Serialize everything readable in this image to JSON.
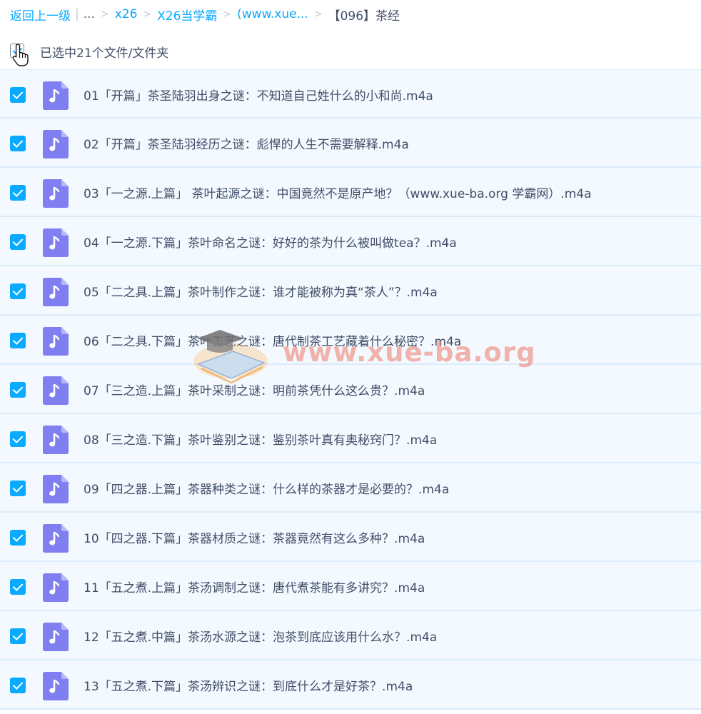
{
  "breadcrumb": {
    "back": "返回上一级",
    "pipe": "|",
    "ellipsis": "...",
    "separator": ">",
    "items": [
      "x26",
      "X26当学霸",
      "(www.xue..."
    ],
    "current": "【096】茶经"
  },
  "selection": {
    "label": "已选中21个文件/文件夹",
    "checked": true
  },
  "watermark": {
    "text": "www.xue-ba.org"
  },
  "colors": {
    "accent": "#09aaff",
    "row_background": "#f3f9ff",
    "file_icon": "#7f7ff1",
    "text": "#424e67"
  },
  "files": [
    {
      "name": "01「开篇」茶圣陆羽出身之谜：不知道自己姓什么的小和尚.m4a",
      "checked": true,
      "icon": "audio-file-icon"
    },
    {
      "name": "02「开篇」茶圣陆羽经历之谜：彪悍的人生不需要解释.m4a",
      "checked": true,
      "icon": "audio-file-icon"
    },
    {
      "name": "03「一之源.上篇」 茶叶起源之谜：中国竟然不是原产地？（www.xue-ba.org 学霸网）.m4a",
      "checked": true,
      "icon": "audio-file-icon"
    },
    {
      "name": "04「一之源.下篇」茶叶命名之谜：好好的茶为什么被叫做tea？.m4a",
      "checked": true,
      "icon": "audio-file-icon"
    },
    {
      "name": "05「二之具.上篇」茶叶制作之谜：谁才能被称为真“茶人”？.m4a",
      "checked": true,
      "icon": "audio-file-icon"
    },
    {
      "name": "06「二之具.下篇」茶叶工艺之谜：唐代制茶工艺藏着什么秘密？.m4a",
      "checked": true,
      "icon": "audio-file-icon"
    },
    {
      "name": "07「三之造.上篇」茶叶采制之谜：明前茶凭什么这么贵？.m4a",
      "checked": true,
      "icon": "audio-file-icon"
    },
    {
      "name": "08「三之造.下篇」茶叶鉴别之谜：鉴别茶叶真有奥秘窍门？.m4a",
      "checked": true,
      "icon": "audio-file-icon"
    },
    {
      "name": "09「四之器.上篇」茶器种类之谜：什么样的茶器才是必要的？.m4a",
      "checked": true,
      "icon": "audio-file-icon"
    },
    {
      "name": "10「四之器.下篇」茶器材质之谜：茶器竟然有这么多种？.m4a",
      "checked": true,
      "icon": "audio-file-icon"
    },
    {
      "name": "11「五之煮.上篇」茶汤调制之谜：唐代煮茶能有多讲究？.m4a",
      "checked": true,
      "icon": "audio-file-icon"
    },
    {
      "name": "12「五之煮.中篇」茶汤水源之谜：泡茶到底应该用什么水？.m4a",
      "checked": true,
      "icon": "audio-file-icon"
    },
    {
      "name": "13「五之煮.下篇」茶汤辨识之谜：到底什么才是好茶？.m4a",
      "checked": true,
      "icon": "audio-file-icon"
    }
  ]
}
